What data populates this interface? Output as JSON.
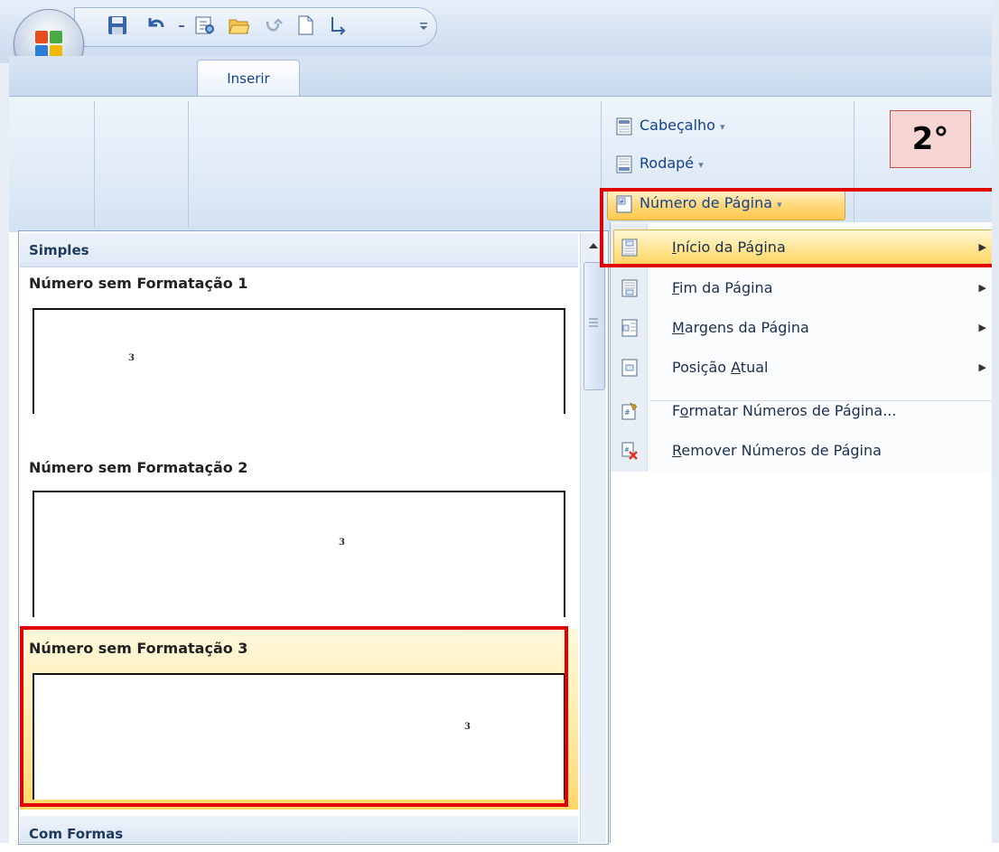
{
  "tabs": {
    "insert": "Inserir"
  },
  "ribbon": {
    "header_label": "Cabeçalho",
    "footer_label": "Rodapé",
    "page_number_label": "Número de Página",
    "dropdown_glyph": "▾"
  },
  "step_label": "2°",
  "gallery": {
    "category_simple": "Simples",
    "category_shapes": "Com Formas",
    "items": [
      {
        "title": "Número sem Formatação 1",
        "preview_number": "3"
      },
      {
        "title": "Número sem Formatação 2",
        "preview_number": "3"
      },
      {
        "title": "Número sem Formatação 3",
        "preview_number": "3"
      }
    ]
  },
  "menu": {
    "inicio": {
      "key": "I",
      "rest": "nício da Página"
    },
    "fim": {
      "key": "F",
      "rest": "im da Página"
    },
    "margens": {
      "key": "M",
      "rest": "argens da Página"
    },
    "posicao": {
      "pre": "Posição ",
      "key": "A",
      "rest": "tual"
    },
    "formatar": {
      "pre": "F",
      "key": "o",
      "rest": "rmatar Números de Página..."
    },
    "remover": {
      "key": "R",
      "rest": "emover Números de Página"
    },
    "submenu_arrow": "▶"
  },
  "colors": {
    "highlight_red": "#e00000",
    "ribbon_blue": "#15428b",
    "hover_gold": "#ffd35e"
  }
}
